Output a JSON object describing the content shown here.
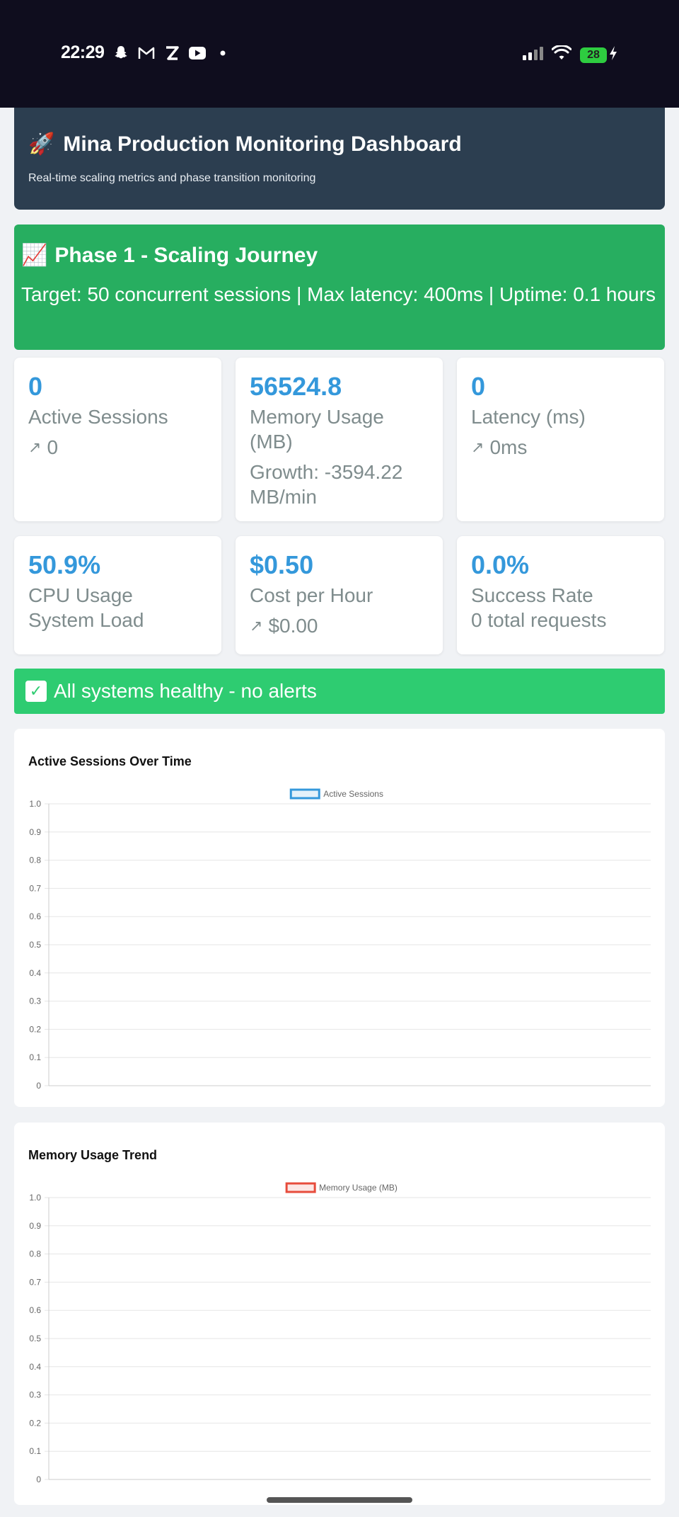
{
  "status_bar": {
    "time": "22:29",
    "battery": "28",
    "icons": [
      "snapchat-icon",
      "gmail-icon",
      "z-app-icon",
      "youtube-icon",
      "dot-icon",
      "signal-icon",
      "wifi-icon",
      "battery-icon",
      "charging-icon"
    ]
  },
  "header": {
    "icon": "🚀",
    "title": "Mina Production Monitoring Dashboard",
    "subtitle": "Real-time scaling metrics and phase transition monitoring"
  },
  "phase": {
    "icon": "📈",
    "title": "Phase 1 - Scaling Journey",
    "details": "Target: 50 concurrent sessions | Max latency: 400ms | Uptime: 0.1 hours"
  },
  "metrics": [
    {
      "value": "0",
      "label": "Active Sessions",
      "trend_icon": "↗",
      "sub": "0"
    },
    {
      "value": "56524.8",
      "label": "Memory Usage (MB)",
      "sub": "Growth: -3594.22 MB/min"
    },
    {
      "value": "0",
      "label": "Latency (ms)",
      "trend_icon": "↗",
      "sub": "0ms"
    },
    {
      "value": "50.9%",
      "label": "CPU Usage",
      "sub": "System Load"
    },
    {
      "value": "$0.50",
      "label": "Cost per Hour",
      "trend_icon": "↗",
      "sub": "$0.00"
    },
    {
      "value": "0.0%",
      "label": "Success Rate",
      "sub": "0 total requests"
    }
  ],
  "alert": {
    "icon": "✓",
    "text": "All systems healthy - no alerts",
    "color": "#2ecc71"
  },
  "colors": {
    "accent": "#3498db",
    "header_bg": "#2c3e50",
    "phase_bg": "#27ae60",
    "memory_series": "#e74c3c"
  },
  "chart_data": [
    {
      "type": "line",
      "title": "Active Sessions Over Time",
      "series": [
        {
          "name": "Active Sessions",
          "color": "#3498db",
          "values": []
        }
      ],
      "x": [],
      "ylim": [
        0,
        1.0
      ],
      "yticks": [
        "1.0",
        "0.9",
        "0.8",
        "0.7",
        "0.6",
        "0.5",
        "0.4",
        "0.3",
        "0.2",
        "0.1",
        "0"
      ],
      "grid": true,
      "legend": "top-center"
    },
    {
      "type": "line",
      "title": "Memory Usage Trend",
      "series": [
        {
          "name": "Memory Usage (MB)",
          "color": "#e74c3c",
          "values": []
        }
      ],
      "x": [],
      "ylim": [
        0,
        1.0
      ],
      "yticks": [
        "1.0",
        "0.9",
        "0.8",
        "0.7",
        "0.6",
        "0.5",
        "0.4",
        "0.3",
        "0.2",
        "0.1",
        "0"
      ],
      "grid": true,
      "legend": "top-center"
    }
  ]
}
